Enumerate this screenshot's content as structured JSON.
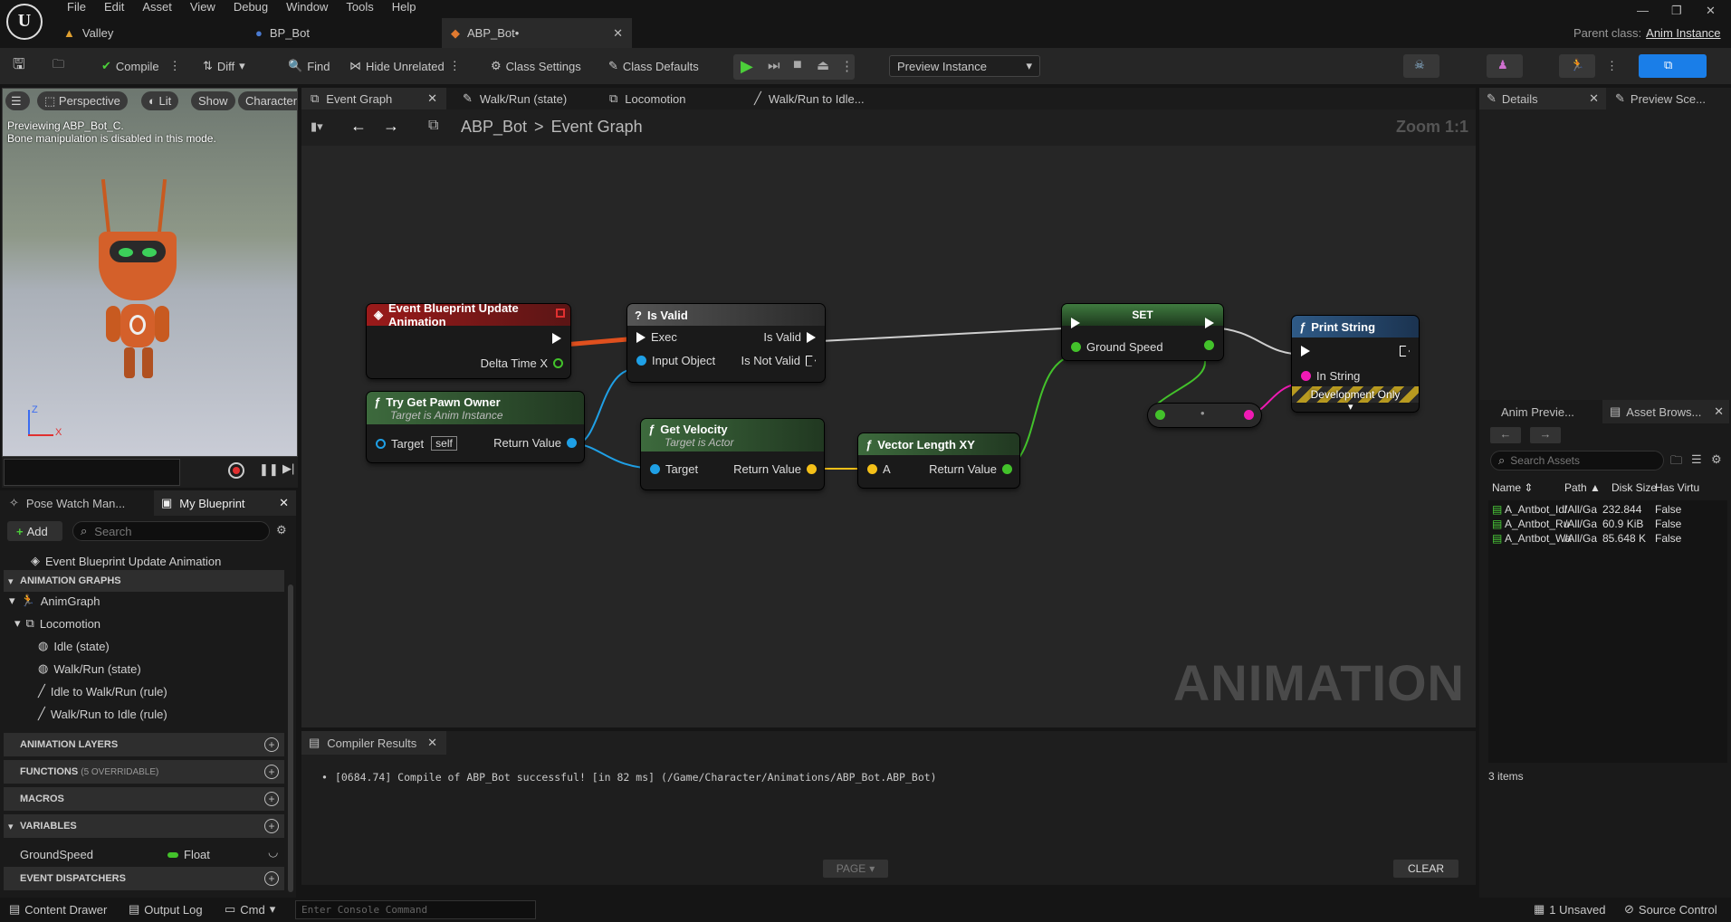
{
  "menu": [
    "File",
    "Edit",
    "Asset",
    "View",
    "Debug",
    "Window",
    "Tools",
    "Help"
  ],
  "doc_tabs": [
    "Valley",
    "BP_Bot",
    "ABP_Bot•"
  ],
  "parent_class_label": "Parent class:",
  "parent_class_value": "Anim Instance",
  "toolbar": {
    "compile": "Compile",
    "diff": "Diff",
    "find": "Find",
    "hide_unrelated": "Hide Unrelated",
    "class_settings": "Class Settings",
    "class_defaults": "Class Defaults",
    "preview_instance": "Preview Instance"
  },
  "viewport": {
    "perspective": "Perspective",
    "lit": "Lit",
    "show": "Show",
    "character": "Character",
    "info_line1": "Previewing ABP_Bot_C.",
    "info_line2": "Bone manipulation is disabled in this mode.",
    "axis_z": "Z",
    "axis_x": "X"
  },
  "left_tabs": [
    "Pose Watch Man...",
    "My Blueprint"
  ],
  "my_blueprint": {
    "add": "Add",
    "search_placeholder": "Search",
    "event_item": "Event Blueprint Update Animation",
    "anim_graphs": "ANIMATION GRAPHS",
    "anim_graph": "AnimGraph",
    "locomotion": "Locomotion",
    "idle_state": "Idle (state)",
    "walkrun_state": "Walk/Run (state)",
    "idle_to_walk": "Idle to Walk/Run (rule)",
    "walk_to_idle": "Walk/Run to Idle (rule)",
    "anim_layers": "ANIMATION LAYERS",
    "functions": "FUNCTIONS",
    "functions_note": "(5 OVERRIDABLE)",
    "macros": "MACROS",
    "variables": "VARIABLES",
    "var_name": "GroundSpeed",
    "var_type": "Float",
    "event_dispatchers": "EVENT DISPATCHERS"
  },
  "graph_tabs": [
    "Event Graph",
    "Walk/Run (state)",
    "Locomotion",
    "Walk/Run to Idle..."
  ],
  "breadcrumb": {
    "root": "ABP_Bot",
    "sep": ">",
    "current": "Event Graph"
  },
  "zoom": "Zoom 1:1",
  "watermark": "ANIMATION",
  "nodes": {
    "event": {
      "title": "Event Blueprint Update Animation",
      "pin": "Delta Time X"
    },
    "isvalid": {
      "title": "Is Valid",
      "exec": "Exec",
      "input": "Input Object",
      "out1": "Is Valid",
      "out2": "Is Not Valid"
    },
    "trygetpawn": {
      "title": "Try Get Pawn Owner",
      "sub": "Target is Anim Instance",
      "target": "Target",
      "self": "self",
      "ret": "Return Value"
    },
    "getvelocity": {
      "title": "Get Velocity",
      "sub": "Target is Actor",
      "target": "Target",
      "ret": "Return Value"
    },
    "vectorlength": {
      "title": "Vector Length XY",
      "a": "A",
      "ret": "Return Value"
    },
    "set": {
      "title": "SET",
      "pin": "Ground Speed"
    },
    "printstring": {
      "title": "Print String",
      "pin": "In String",
      "dev": "Development Only"
    }
  },
  "compiler": {
    "tab": "Compiler Results",
    "message": "[0684.74] Compile of ABP_Bot successful! [in 82 ms] (/Game/Character/Animations/ABP_Bot.ABP_Bot)",
    "page": "PAGE",
    "clear": "CLEAR"
  },
  "right_tabs": [
    "Details",
    "Preview Sce..."
  ],
  "bottom_right_tabs": [
    "Anim Previe...",
    "Asset Brows..."
  ],
  "asset_browser": {
    "search_placeholder": "Search Assets",
    "columns": [
      "Name",
      "Path",
      "Disk Size",
      "Has Virtu"
    ],
    "rows": [
      [
        "A_Antbot_Idl",
        "/All/Ga",
        "232.844",
        "False"
      ],
      [
        "A_Antbot_Ru",
        "/All/Ga",
        "60.9 KiB",
        "False"
      ],
      [
        "A_Antbot_Wa",
        "/All/Ga",
        "85.648 K",
        "False"
      ]
    ],
    "count": "3 items"
  },
  "statusbar": {
    "content_drawer": "Content Drawer",
    "output_log": "Output Log",
    "cmd": "Cmd",
    "console_placeholder": "Enter Console Command",
    "unsaved": "1 Unsaved",
    "source_control": "Source Control"
  },
  "colors": {
    "exec_red": "#c83d1e",
    "float_green": "#43c22b",
    "object_blue": "#1fa0e6",
    "vector_yellow": "#f4c018",
    "string_magenta": "#f01ab4",
    "accent_blue": "#1a7ee8"
  }
}
